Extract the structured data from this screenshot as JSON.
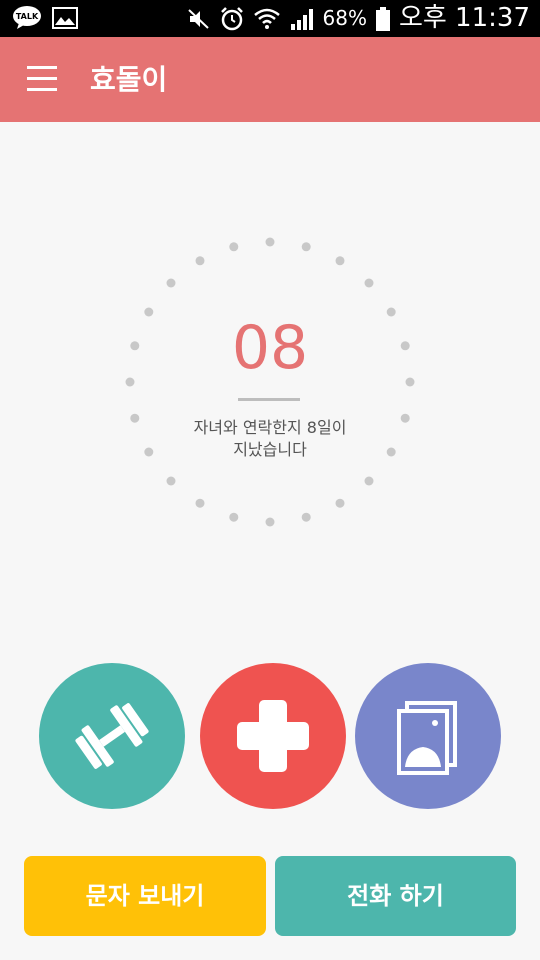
{
  "status_bar": {
    "left_icons": [
      "kakaotalk-icon",
      "image-icon"
    ],
    "kakao_label": "TALK",
    "right_icons": [
      "mute-icon",
      "alarm-icon",
      "wifi-icon",
      "signal-icon",
      "battery-icon"
    ],
    "battery": "68%",
    "time": "오후 11:37"
  },
  "app_bar": {
    "title": "효돌이",
    "menu_icon": "menu-icon"
  },
  "counter": {
    "days": "08",
    "message_line1": "자녀와 연락한지 8일이",
    "message_line2": "지났습니다",
    "accent_color": "#e57373"
  },
  "feature_buttons": [
    {
      "name": "fitness",
      "icon": "dumbbell-icon",
      "color": "#4db6ac"
    },
    {
      "name": "health",
      "icon": "medical-cross-icon",
      "color": "#ef5350"
    },
    {
      "name": "photos",
      "icon": "photo-gallery-icon",
      "color": "#7986cb"
    }
  ],
  "actions": {
    "sms_label": "문자 보내기",
    "call_label": "전화 하기",
    "sms_color": "#ffc107",
    "call_color": "#4db6ac"
  }
}
